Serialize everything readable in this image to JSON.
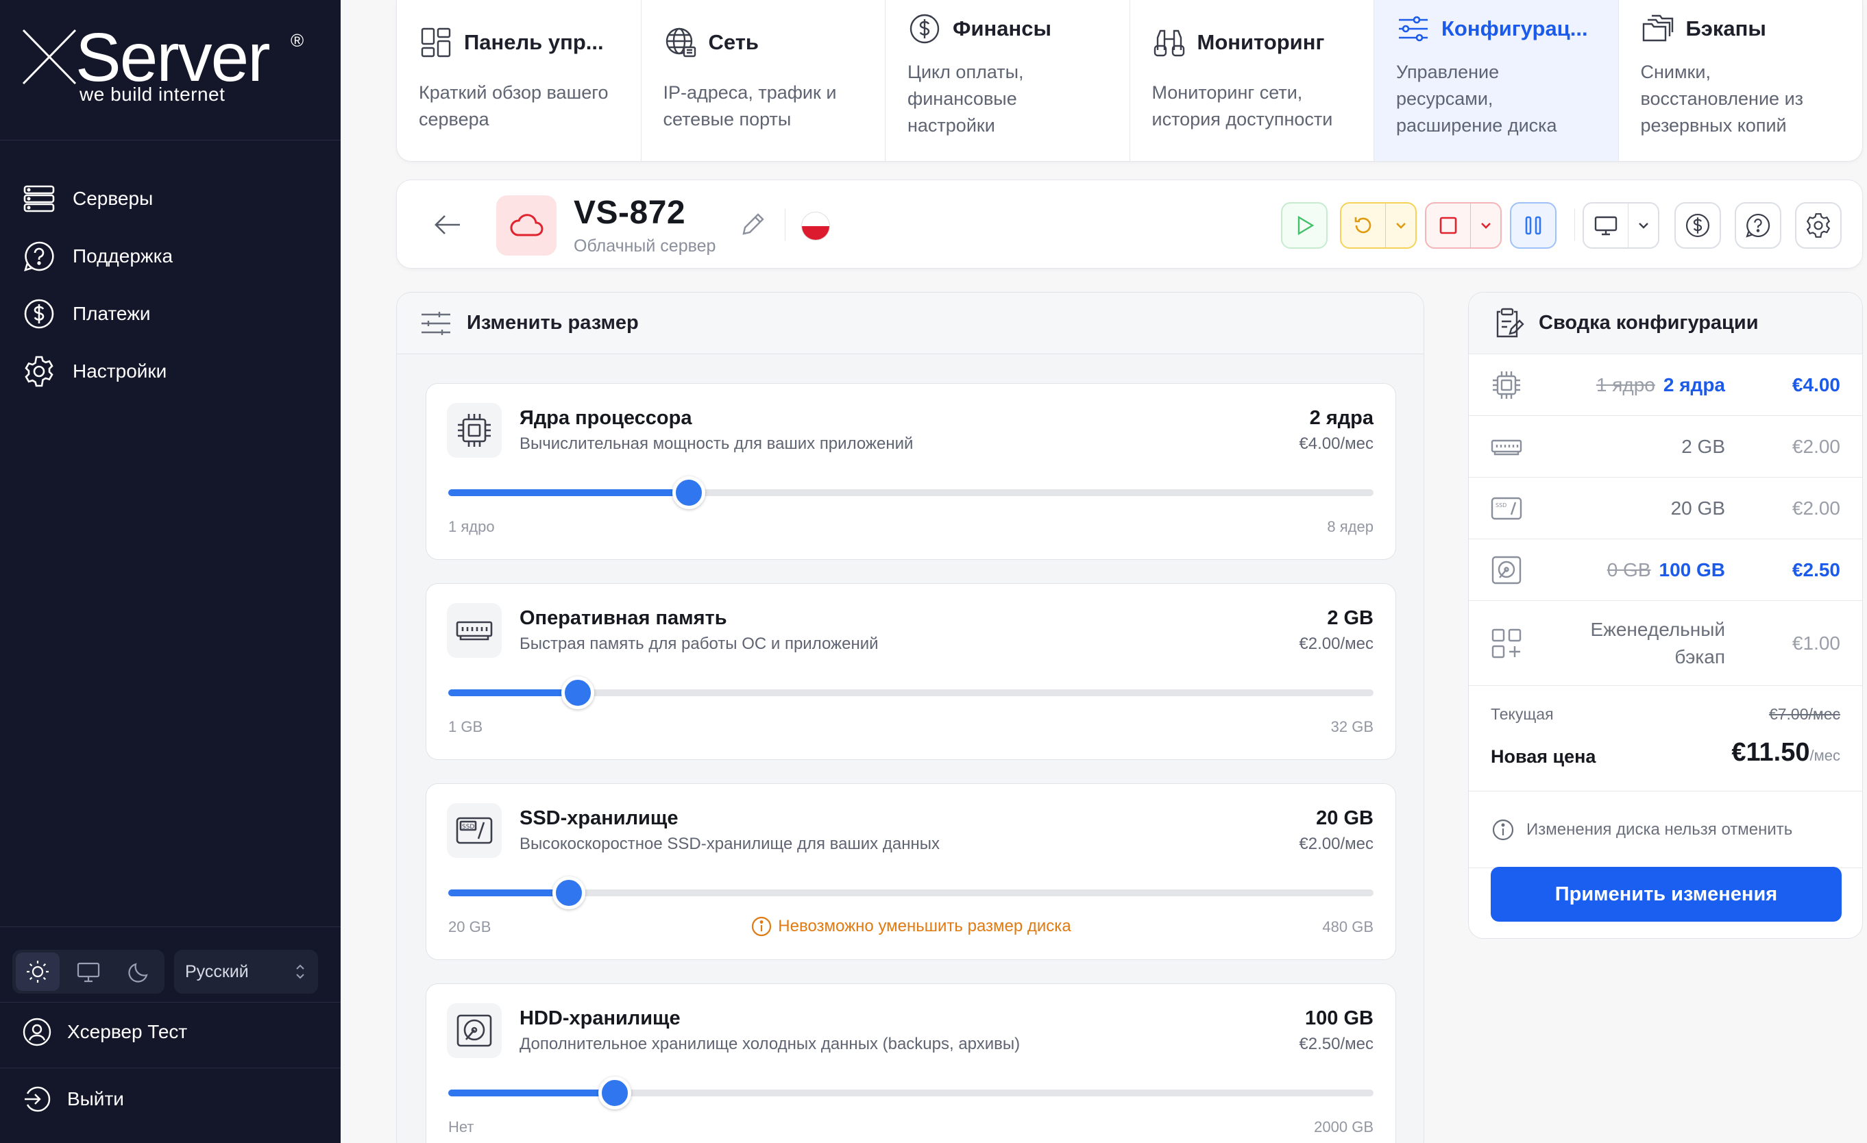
{
  "brand": {
    "name": "Server",
    "reg": "®",
    "tagline": "we build internet"
  },
  "sidebar": {
    "items": [
      {
        "label": "Серверы",
        "icon": "servers-icon"
      },
      {
        "label": "Поддержка",
        "icon": "help-icon"
      },
      {
        "label": "Платежи",
        "icon": "dollar-icon"
      },
      {
        "label": "Настройки",
        "icon": "gear-icon"
      }
    ],
    "language": "Русский",
    "user": "Хсервер Тест",
    "logout": "Выйти"
  },
  "tabs": [
    {
      "title": "Панель упр...",
      "desc": "Краткий обзор вашего сервера"
    },
    {
      "title": "Сеть",
      "desc": "IP-адреса, трафик и сетевые порты"
    },
    {
      "title": "Финансы",
      "desc": "Цикл оплаты, финансовые настройки"
    },
    {
      "title": "Мониторинг",
      "desc": "Мониторинг сети, история доступности"
    },
    {
      "title": "Конфигурац...",
      "desc": "Управление ресурсами, расширение диска"
    },
    {
      "title": "Бэкапы",
      "desc": "Снимки, восстановление из резервных копий"
    }
  ],
  "server": {
    "name": "VS-872",
    "type": "Облачный сервер"
  },
  "resize": {
    "title": "Изменить размер",
    "cards": [
      {
        "title": "Ядра процессора",
        "sub": "Вычислительная мощность для ваших приложений",
        "value": "2 ядра",
        "price": "€4.00/мес",
        "min": "1 ядро",
        "max": "8 ядер",
        "level": 0.26
      },
      {
        "title": "Оперативная память",
        "sub": "Быстрая память для работы ОС и приложений",
        "value": "2 GB",
        "price": "€2.00/мес",
        "min": "1 GB",
        "max": "32 GB",
        "level": 0.14
      },
      {
        "title": "SSD-хранилище",
        "sub": "Высокоскоростное SSD-хранилище для ваших данных",
        "value": "20 GB",
        "price": "€2.00/мес",
        "min": "20 GB",
        "max": "480 GB",
        "level": 0.13,
        "warning": "Невозможно уменьшить размер диска"
      },
      {
        "title": "HDD-хранилище",
        "sub": "Дополнительное хранилище холодных данных (backups, архивы)",
        "value": "100 GB",
        "price": "€2.50/мес",
        "min": "Нет",
        "max": "2000 GB",
        "level": 0.18
      }
    ]
  },
  "summary": {
    "title": "Сводка конфигурации",
    "rows": [
      {
        "old": "1 ядро",
        "new": "2 ядра",
        "price": "€4.00"
      },
      {
        "value": "2 GB",
        "price": "€2.00"
      },
      {
        "value": "20 GB",
        "price": "€2.00"
      },
      {
        "old": "0 GB",
        "new": "100 GB",
        "price": "€2.50"
      },
      {
        "value_line1": "Еженедельный",
        "value_line2": "бэкап",
        "price": "€1.00"
      }
    ],
    "current_label": "Текущая",
    "current_value": "€7.00/мес",
    "new_label": "Новая цена",
    "new_value": "€11.50",
    "new_unit": "/мес",
    "note": "Изменения диска нельзя отменить",
    "apply": "Применить изменения"
  },
  "colors": {
    "accent": "#1a5ff0",
    "sidebar": "#14172a",
    "warning": "#e07a12",
    "danger": "#e0232f",
    "success": "#44c06a"
  }
}
